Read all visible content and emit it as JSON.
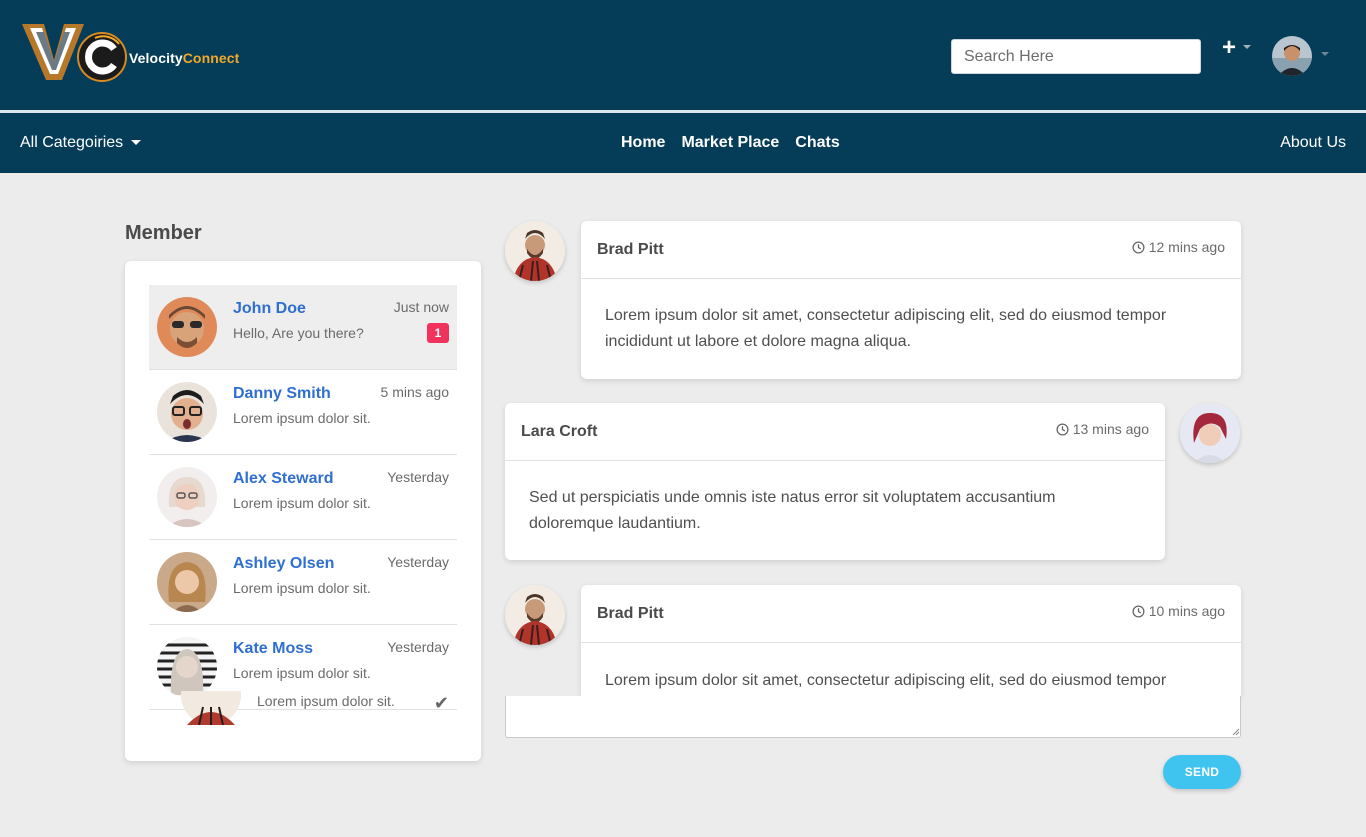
{
  "brand": {
    "name_part1": "Velocity",
    "name_part2": "Connect",
    "accent_color": "#f0a92a"
  },
  "header": {
    "search_placeholder": "Search Here",
    "add_label": "+"
  },
  "nav": {
    "categories_label": "All Categoiries",
    "links": [
      {
        "label": "Home"
      },
      {
        "label": "Market Place"
      },
      {
        "label": "Chats"
      }
    ],
    "about_label": "About Us"
  },
  "members": {
    "title": "Member",
    "items": [
      {
        "name": "John Doe",
        "snippet": "Hello, Are you there?",
        "time": "Just now",
        "badge": "1",
        "active": true
      },
      {
        "name": "Danny Smith",
        "snippet": "Lorem ipsum dolor sit.",
        "time": "5 mins ago"
      },
      {
        "name": "Alex Steward",
        "snippet": "Lorem ipsum dolor sit.",
        "time": "Yesterday"
      },
      {
        "name": "Ashley Olsen",
        "snippet": "Lorem ipsum dolor sit.",
        "time": "Yesterday"
      },
      {
        "name": "Kate Moss",
        "snippet": "Lorem ipsum dolor sit.",
        "time": "Yesterday"
      }
    ],
    "extra_snippet": "Lorem ipsum dolor sit."
  },
  "chat": {
    "messages": [
      {
        "author": "Brad Pitt",
        "time": "12 mins ago",
        "text": "Lorem ipsum dolor sit amet, consectetur adipiscing elit, sed do eiusmod tempor incididunt ut labore et dolore magna aliqua."
      },
      {
        "author": "Lara Croft",
        "time": "13 mins ago",
        "text": "Sed ut perspiciatis unde omnis iste natus error sit voluptatem accusantium doloremque laudantium."
      },
      {
        "author": "Brad Pitt",
        "time": "10 mins ago",
        "text": "Lorem ipsum dolor sit amet, consectetur adipiscing elit, sed do eiusmod tempor"
      }
    ],
    "send_label": "SEND"
  }
}
